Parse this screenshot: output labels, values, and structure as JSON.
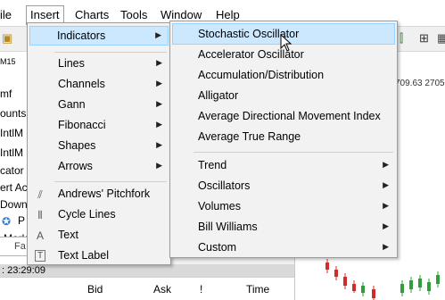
{
  "menubar": {
    "items": [
      {
        "label": "File",
        "display": "ile"
      },
      {
        "label": "Insert"
      },
      {
        "label": "Charts"
      },
      {
        "label": "Tools"
      },
      {
        "label": "Window"
      },
      {
        "label": "Help"
      }
    ]
  },
  "toolbar": {
    "icons": [
      "new-chart-icon",
      "chart-zoom-icon",
      "period-button",
      "grid-icon"
    ]
  },
  "left_panel": {
    "timeframe": "M15",
    "rows": [
      "mf",
      "ounts",
      "IntlM",
      "IntlM",
      "cator",
      "ert Ac",
      "Down",
      "P",
      "Mark",
      "Fa"
    ],
    "time_label": ": 23:29:09",
    "columns": [
      "Bid",
      "Ask",
      "!",
      "Time"
    ]
  },
  "chart": {
    "price_line": "709.63 2705"
  },
  "insert_menu": {
    "items": [
      {
        "label": "Indicators",
        "has_submenu": true,
        "highlighted": true
      },
      {
        "label": "Lines",
        "has_submenu": true
      },
      {
        "label": "Channels",
        "has_submenu": true
      },
      {
        "label": "Gann",
        "has_submenu": true
      },
      {
        "label": "Fibonacci",
        "has_submenu": true
      },
      {
        "label": "Shapes",
        "has_submenu": true
      },
      {
        "label": "Arrows",
        "has_submenu": true
      },
      {
        "label": "Andrews' Pitchfork",
        "icon": "pitchfork-icon"
      },
      {
        "label": "Cycle Lines",
        "icon": "cycle-lines-icon"
      },
      {
        "label": "Text",
        "icon": "text-icon"
      },
      {
        "label": "Text Label",
        "icon": "text-label-icon"
      }
    ]
  },
  "indicators_menu": {
    "items": [
      {
        "label": "Stochastic Oscillator",
        "highlighted": true
      },
      {
        "label": "Accelerator Oscillator"
      },
      {
        "label": "Accumulation/Distribution"
      },
      {
        "label": "Alligator"
      },
      {
        "label": "Average Directional Movement Index"
      },
      {
        "label": "Average True Range"
      },
      {
        "label": "Trend",
        "has_submenu": true
      },
      {
        "label": "Oscillators",
        "has_submenu": true
      },
      {
        "label": "Volumes",
        "has_submenu": true
      },
      {
        "label": "Bill Williams",
        "has_submenu": true
      },
      {
        "label": "Custom",
        "has_submenu": true
      }
    ]
  },
  "colors": {
    "highlight_bg": "#cce8ff",
    "highlight_border": "#99d1ff",
    "bull_candle": "#2e9e3e",
    "bear_candle": "#d22b2b"
  }
}
